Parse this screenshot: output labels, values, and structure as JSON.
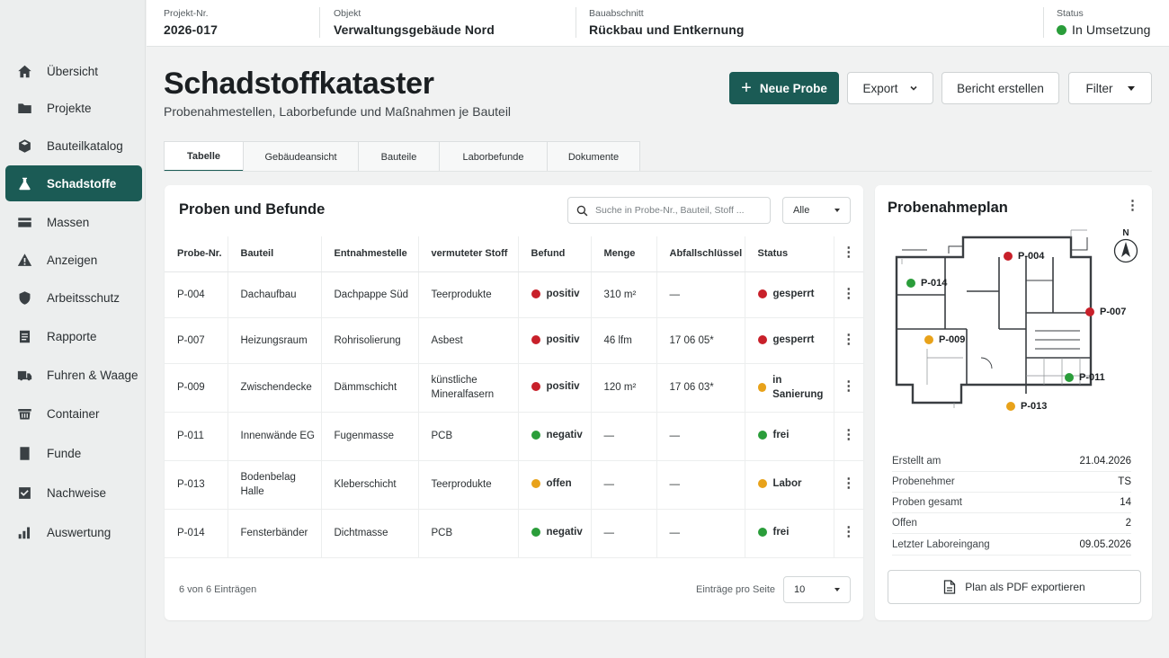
{
  "sidebar": {
    "items": [
      {
        "label": "Übersicht",
        "icon": "home-icon"
      },
      {
        "label": "Projekte",
        "icon": "folder-icon"
      },
      {
        "label": "Bauteilkatalog",
        "icon": "cube-icon"
      },
      {
        "label": "Schadstoffe",
        "icon": "flask-icon",
        "active": true
      },
      {
        "label": "Massen",
        "icon": "card-icon"
      },
      {
        "label": "Anzeigen",
        "icon": "warning-icon"
      },
      {
        "label": "Arbeitsschutz",
        "icon": "shield-icon"
      },
      {
        "label": "Rapporte",
        "icon": "document-icon"
      },
      {
        "label": "Fuhren & Waage",
        "icon": "truck-icon"
      },
      {
        "label": "Container",
        "icon": "container-icon"
      },
      {
        "label": "Funde",
        "icon": "bookmark-icon"
      },
      {
        "label": "Nachweise",
        "icon": "checkbox-icon"
      },
      {
        "label": "Auswertung",
        "icon": "bar-chart-icon"
      }
    ]
  },
  "header": {
    "projekt": {
      "label": "Projekt-Nr.",
      "value": "2026-017"
    },
    "objekt": {
      "label": "Objekt",
      "value": "Verwaltungsgebäude Nord"
    },
    "bauabschnitt": {
      "label": "Bauabschnitt",
      "value": "Rückbau und Entkernung"
    },
    "status": {
      "label": "Status",
      "value": "In Umsetzung",
      "color": "#2a9d3a"
    }
  },
  "page": {
    "title": "Schadstoffkataster",
    "subtitle": "Probenahmestellen, Laborbefunde und Maßnahmen je Bauteil"
  },
  "actions": {
    "new": "Neue Probe",
    "export": "Export",
    "report": "Bericht erstellen",
    "filter": "Filter"
  },
  "tabs": [
    "Tabelle",
    "Gebäudeansicht",
    "Bauteile",
    "Laborbefunde",
    "Dokumente"
  ],
  "table": {
    "title": "Proben und Befunde",
    "search_placeholder": "Suche in Probe-Nr., Bauteil, Stoff ...",
    "filter_value": "Alle",
    "columns": [
      "Probe-Nr.",
      "Bauteil",
      "Entnahmestelle",
      "vermuteter Stoff",
      "Befund",
      "Menge",
      "Abfallschlüssel",
      "Status"
    ],
    "rows": [
      {
        "id": "P-004",
        "bauteil": "Dachaufbau",
        "stelle": "Dachpappe Süd",
        "stoff": "Teerprodukte",
        "befund": "positiv",
        "befund_color": "#c8202a",
        "menge": "310 m²",
        "schluessel": "—",
        "status": "gesperrt",
        "status_color": "#c8202a"
      },
      {
        "id": "P-007",
        "bauteil": "Heizungsraum",
        "stelle": "Rohrisolierung",
        "stoff": "Asbest",
        "befund": "positiv",
        "befund_color": "#c8202a",
        "menge": "46 lfm",
        "schluessel": "17 06 05*",
        "status": "gesperrt",
        "status_color": "#c8202a"
      },
      {
        "id": "P-009",
        "bauteil": "Zwischendecke",
        "stelle": "Dämmschicht",
        "stoff": "künstliche Mineralfasern",
        "befund": "positiv",
        "befund_color": "#c8202a",
        "menge": "120 m²",
        "schluessel": "17 06 03*",
        "status": "in Sanierung",
        "status_color": "#e8a21a"
      },
      {
        "id": "P-011",
        "bauteil": "Innenwände EG",
        "stelle": "Fugenmasse",
        "stoff": "PCB",
        "befund": "negativ",
        "befund_color": "#2a9d3a",
        "menge": "—",
        "schluessel": "—",
        "status": "frei",
        "status_color": "#2a9d3a"
      },
      {
        "id": "P-013",
        "bauteil": "Bodenbelag Halle",
        "stelle": "Kleberschicht",
        "stoff": "Teerprodukte",
        "befund": "offen",
        "befund_color": "#e8a21a",
        "menge": "—",
        "schluessel": "—",
        "status": "Labor",
        "status_color": "#e8a21a"
      },
      {
        "id": "P-014",
        "bauteil": "Fensterbänder",
        "stelle": "Dichtmasse",
        "stoff": "PCB",
        "befund": "negativ",
        "befund_color": "#2a9d3a",
        "menge": "—",
        "schluessel": "—",
        "status": "frei",
        "status_color": "#2a9d3a"
      }
    ],
    "count_text": "6 von 6 Einträgen",
    "per_page_label": "Einträge pro Seite",
    "per_page_value": "10"
  },
  "plan": {
    "title": "Probenahmeplan",
    "compass": "N",
    "pins": [
      {
        "id": "P-004",
        "color": "#c8202a"
      },
      {
        "id": "P-014",
        "color": "#2a9d3a"
      },
      {
        "id": "P-007",
        "color": "#c8202a"
      },
      {
        "id": "P-009",
        "color": "#e8a21a"
      },
      {
        "id": "P-011",
        "color": "#2a9d3a"
      },
      {
        "id": "P-013",
        "color": "#e8a21a"
      }
    ],
    "info": [
      {
        "label": "Erstellt am",
        "value": "21.04.2026"
      },
      {
        "label": "Probenehmer",
        "value": "TS"
      },
      {
        "label": "Proben gesamt",
        "value": "14"
      },
      {
        "label": "Offen",
        "value": "2"
      },
      {
        "label": "Letzter Laboreingang",
        "value": "09.05.2026"
      }
    ],
    "export_button": "Plan als PDF exportieren"
  },
  "colors": {
    "accent": "#1b5b55",
    "red": "#c8202a",
    "amber": "#e8a21a",
    "green": "#2a9d3a"
  }
}
